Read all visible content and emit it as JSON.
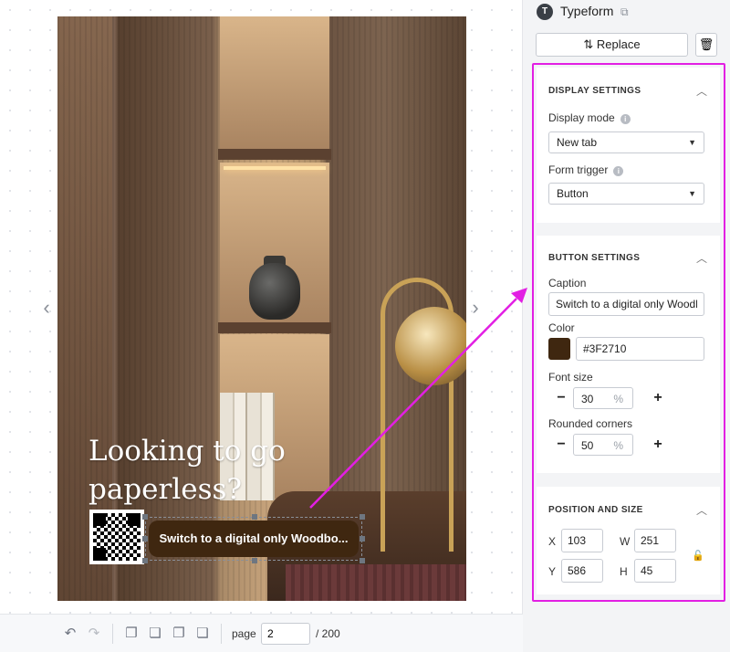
{
  "app": {
    "title": "Typeform",
    "logo_letter": "T"
  },
  "toolbar": {
    "replace_label": "Replace"
  },
  "canvas": {
    "headline_line1": "Looking to go",
    "headline_line2": "paperless?",
    "cta_text": "Switch to a digital only Woodbo..."
  },
  "pagination": {
    "label": "page",
    "current": "2",
    "total": "/ 200"
  },
  "display_settings": {
    "title": "DISPLAY SETTINGS",
    "display_mode_label": "Display mode",
    "display_mode_value": "New tab",
    "form_trigger_label": "Form trigger",
    "form_trigger_value": "Button"
  },
  "button_settings": {
    "title": "BUTTON SETTINGS",
    "caption_label": "Caption",
    "caption_value": "Switch to a digital only Woodbine",
    "color_label": "Color",
    "color_value": "#3F2710",
    "font_size_label": "Font size",
    "font_size_value": "30",
    "rounded_label": "Rounded corners",
    "rounded_value": "50",
    "unit": "%"
  },
  "position_size": {
    "title": "POSITION AND SIZE",
    "x_label": "X",
    "x_value": "103",
    "w_label": "W",
    "w_value": "251",
    "y_label": "Y",
    "y_value": "586",
    "h_label": "H",
    "h_value": "45"
  },
  "colors": {
    "accent": "#E21FE3",
    "button_brown": "#3F2710"
  }
}
